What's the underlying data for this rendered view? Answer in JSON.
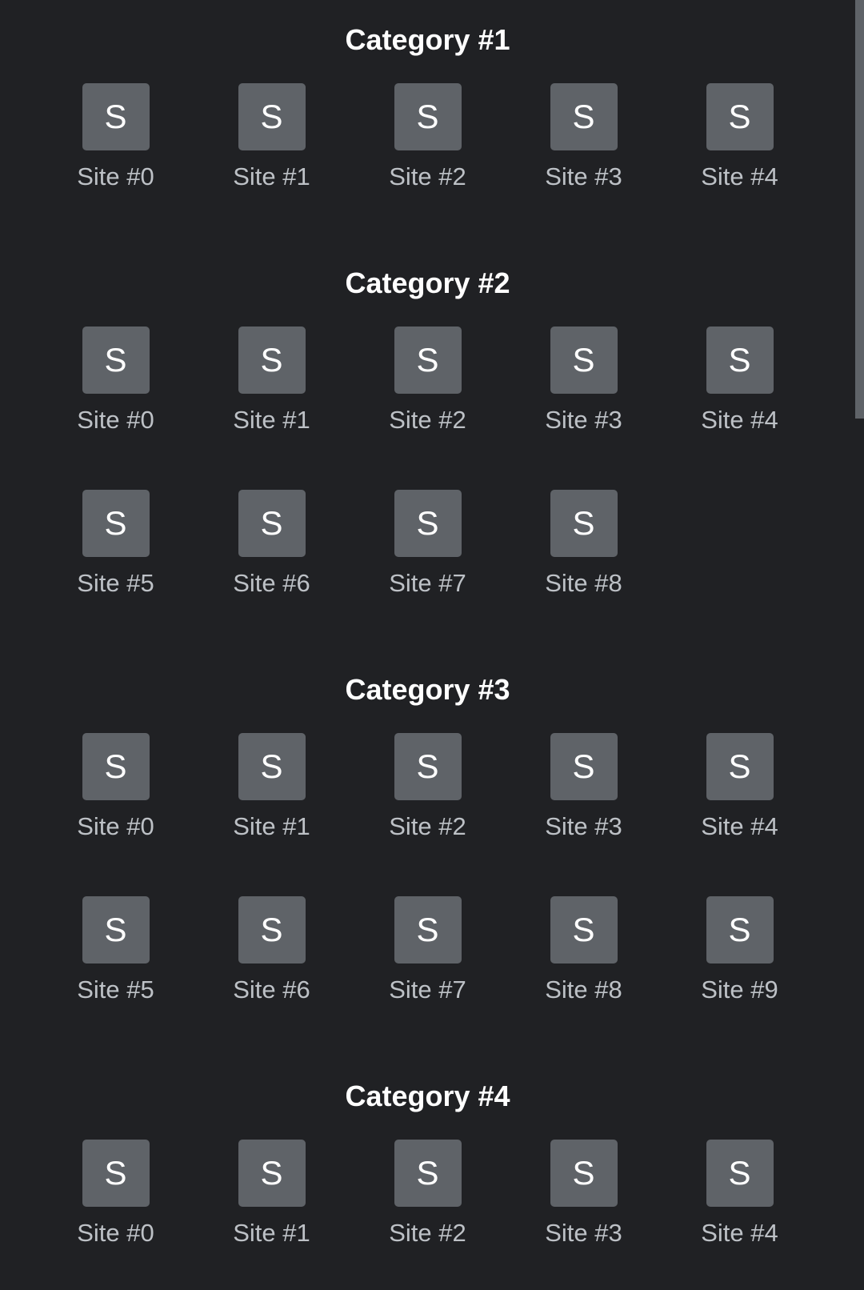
{
  "colors": {
    "background": "#202124",
    "tile": "#5f6368",
    "title": "#ffffff",
    "label": "#bdc1c6",
    "scrollbar_thumb": "#5f6368"
  },
  "categories": [
    {
      "title": "Category #1",
      "sites": [
        {
          "icon_letter": "S",
          "label": "Site #0"
        },
        {
          "icon_letter": "S",
          "label": "Site #1"
        },
        {
          "icon_letter": "S",
          "label": "Site #2"
        },
        {
          "icon_letter": "S",
          "label": "Site #3"
        },
        {
          "icon_letter": "S",
          "label": "Site #4"
        }
      ]
    },
    {
      "title": "Category #2",
      "sites": [
        {
          "icon_letter": "S",
          "label": "Site #0"
        },
        {
          "icon_letter": "S",
          "label": "Site #1"
        },
        {
          "icon_letter": "S",
          "label": "Site #2"
        },
        {
          "icon_letter": "S",
          "label": "Site #3"
        },
        {
          "icon_letter": "S",
          "label": "Site #4"
        },
        {
          "icon_letter": "S",
          "label": "Site #5"
        },
        {
          "icon_letter": "S",
          "label": "Site #6"
        },
        {
          "icon_letter": "S",
          "label": "Site #7"
        },
        {
          "icon_letter": "S",
          "label": "Site #8"
        }
      ]
    },
    {
      "title": "Category #3",
      "sites": [
        {
          "icon_letter": "S",
          "label": "Site #0"
        },
        {
          "icon_letter": "S",
          "label": "Site #1"
        },
        {
          "icon_letter": "S",
          "label": "Site #2"
        },
        {
          "icon_letter": "S",
          "label": "Site #3"
        },
        {
          "icon_letter": "S",
          "label": "Site #4"
        },
        {
          "icon_letter": "S",
          "label": "Site #5"
        },
        {
          "icon_letter": "S",
          "label": "Site #6"
        },
        {
          "icon_letter": "S",
          "label": "Site #7"
        },
        {
          "icon_letter": "S",
          "label": "Site #8"
        },
        {
          "icon_letter": "S",
          "label": "Site #9"
        }
      ]
    },
    {
      "title": "Category #4",
      "sites": [
        {
          "icon_letter": "S",
          "label": "Site #0"
        },
        {
          "icon_letter": "S",
          "label": "Site #1"
        },
        {
          "icon_letter": "S",
          "label": "Site #2"
        },
        {
          "icon_letter": "S",
          "label": "Site #3"
        },
        {
          "icon_letter": "S",
          "label": "Site #4"
        }
      ]
    }
  ]
}
